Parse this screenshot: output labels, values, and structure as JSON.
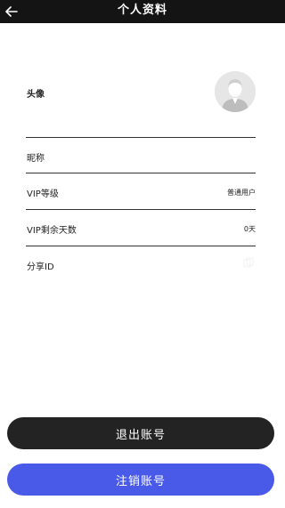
{
  "header": {
    "title": "个人资料",
    "back_icon": "arrow-left-icon"
  },
  "profile": {
    "avatar_label": "头像",
    "nickname_label": "昵称",
    "vip_level_label": "VIP等级",
    "vip_level_value": "普通用户",
    "vip_days_label": "VIP剩余天数",
    "vip_days_value": "0天",
    "share_id_label": "分享ID"
  },
  "actions": {
    "logout_label": "退出账号",
    "cancel_account_label": "注销账号"
  },
  "colors": {
    "header_bg": "#141414",
    "logout_bg": "#232323",
    "cancel_bg": "#4a5ae8"
  }
}
